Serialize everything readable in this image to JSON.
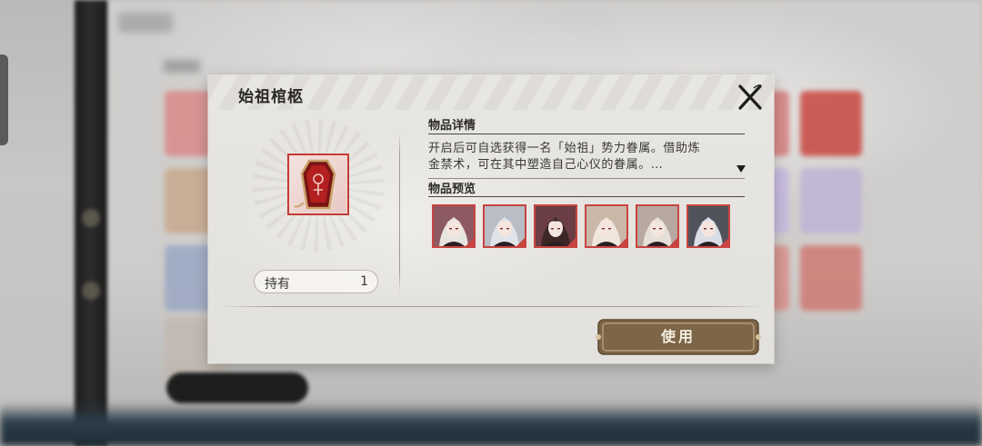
{
  "dialog": {
    "title": "始祖棺柩",
    "close_icon": "close-x-icon"
  },
  "item": {
    "icon": "coffin-icon",
    "owned_label": "持有",
    "owned_count": "1"
  },
  "details": {
    "heading": "物品详情",
    "description_line1": "开启后可自选获得一名「始祖」势力眷属。借助炼",
    "description_line2": "金禁术，可在其中塑造自己心仪的眷属。…",
    "expand_icon": "expand-down-triangle-icon"
  },
  "preview": {
    "heading": "物品预览",
    "characters": [
      {
        "portrait": "character-portrait-1-icon",
        "hair": "#e8e4df",
        "bg": "#8c5a60"
      },
      {
        "portrait": "character-portrait-2-icon",
        "hair": "#dfe3ea",
        "bg": "#b9bdc6"
      },
      {
        "portrait": "character-portrait-3-icon",
        "hair": "#3c2626",
        "bg": "#6b3d44"
      },
      {
        "portrait": "character-portrait-4-icon",
        "hair": "#efe6dc",
        "bg": "#c9b8a8"
      },
      {
        "portrait": "character-portrait-5-icon",
        "hair": "#e6dfd8",
        "bg": "#b7a9a2"
      },
      {
        "portrait": "character-portrait-6-icon",
        "hair": "#d9dde6",
        "bg": "#50525c"
      }
    ]
  },
  "actions": {
    "use_label": "使用"
  },
  "colors": {
    "accent_red": "#c84440",
    "button_brown": "#7d6548"
  }
}
